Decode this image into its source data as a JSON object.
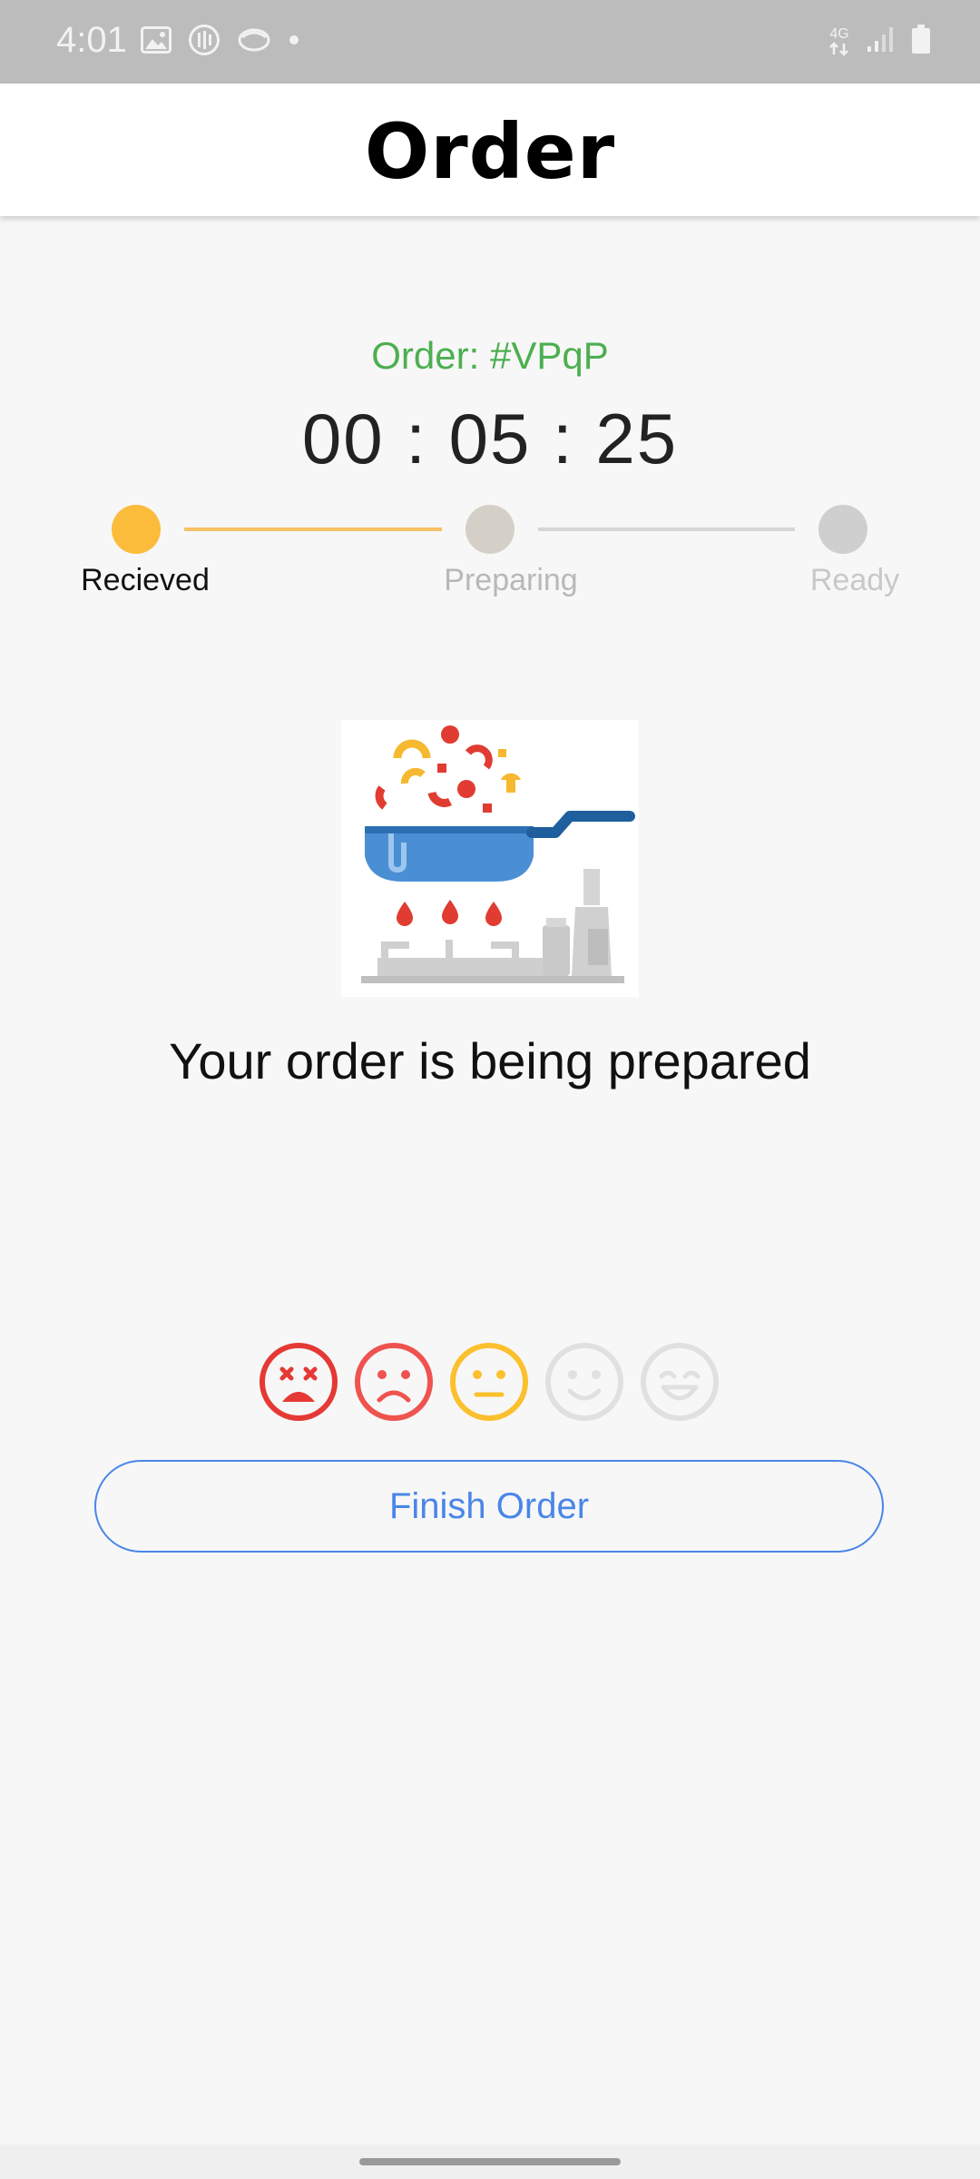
{
  "status_bar": {
    "time": "4:01",
    "network": "4G",
    "left_icons": [
      "image-icon",
      "podcast-icon",
      "app-icon",
      "dot-icon"
    ],
    "right_icons": [
      "network-4g-icon",
      "signal-icon",
      "battery-icon"
    ]
  },
  "app_bar": {
    "title": "Order"
  },
  "order": {
    "id_label": "Order: #VPqP",
    "timer": "00 : 05 : 25",
    "status_message": "Your order is being prepared"
  },
  "progress": {
    "steps": [
      {
        "label": "Recieved",
        "state": "done",
        "color": "#fbbc3c"
      },
      {
        "label": "Preparing",
        "state": "pending",
        "color": "#d5d0c7"
      },
      {
        "label": "Ready",
        "state": "pending",
        "color": "#cfcfcf"
      }
    ],
    "completed_segment_color": "#f5c163",
    "pending_segment_color": "#d6d6d6"
  },
  "illustration": {
    "icon": "cooking-pan-on-stove-icon"
  },
  "rating": {
    "faces": [
      {
        "name": "very-dissatisfied-icon",
        "color": "#e53935",
        "active": true
      },
      {
        "name": "dissatisfied-icon",
        "color": "#ef5350",
        "active": true
      },
      {
        "name": "neutral-icon",
        "color": "#fbc02d",
        "active": true
      },
      {
        "name": "satisfied-icon",
        "color": "#e0e0e0",
        "active": false
      },
      {
        "name": "very-satisfied-icon",
        "color": "#e0e0e0",
        "active": false
      }
    ]
  },
  "actions": {
    "finish_label": "Finish Order"
  },
  "colors": {
    "accent": "#4a86e8",
    "order_id": "#4caf50"
  }
}
